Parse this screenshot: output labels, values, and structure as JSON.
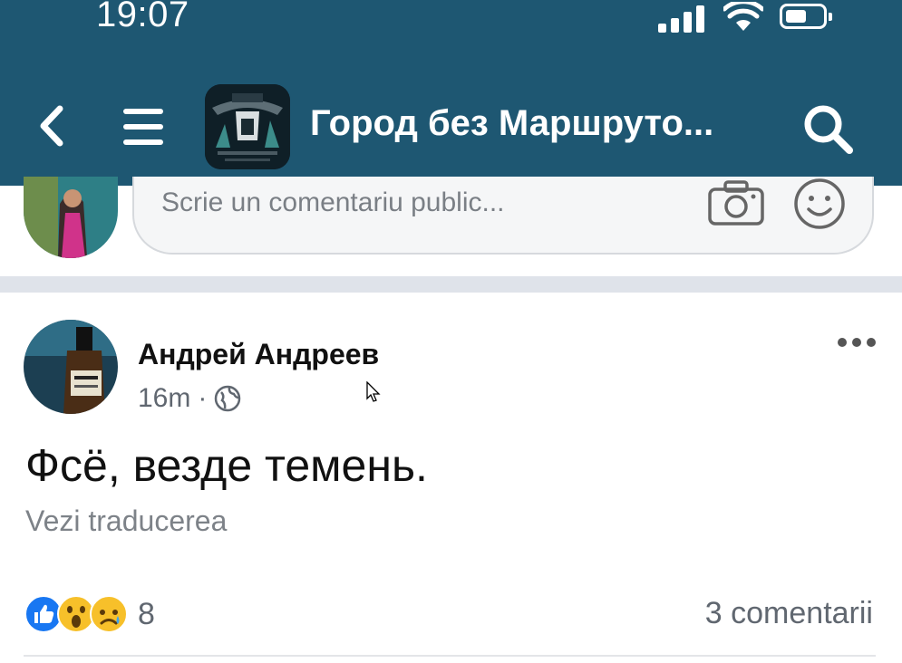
{
  "status_bar": {
    "time": "19:07"
  },
  "header": {
    "group_title": "Город без Маршруто...",
    "icons": [
      "back-chevron-icon",
      "hamburger-menu-icon",
      "search-icon"
    ],
    "colors": {
      "background": "#1e5772",
      "foreground": "#ffffff"
    }
  },
  "comment_box": {
    "placeholder": "Scrie un comentariu public...",
    "icons": [
      "camera-icon",
      "smiley-icon"
    ]
  },
  "post": {
    "author": "Андрей Андреев",
    "time": "16m",
    "separator": "·",
    "privacy_icon": "globe-icon",
    "text": "Фсё, везде темень.",
    "translate_label": "Vezi traducerea",
    "reactions": {
      "icons": [
        "like-icon",
        "wow-icon",
        "sad-icon"
      ],
      "count": "8"
    },
    "comments_label": "3 comentarii"
  }
}
